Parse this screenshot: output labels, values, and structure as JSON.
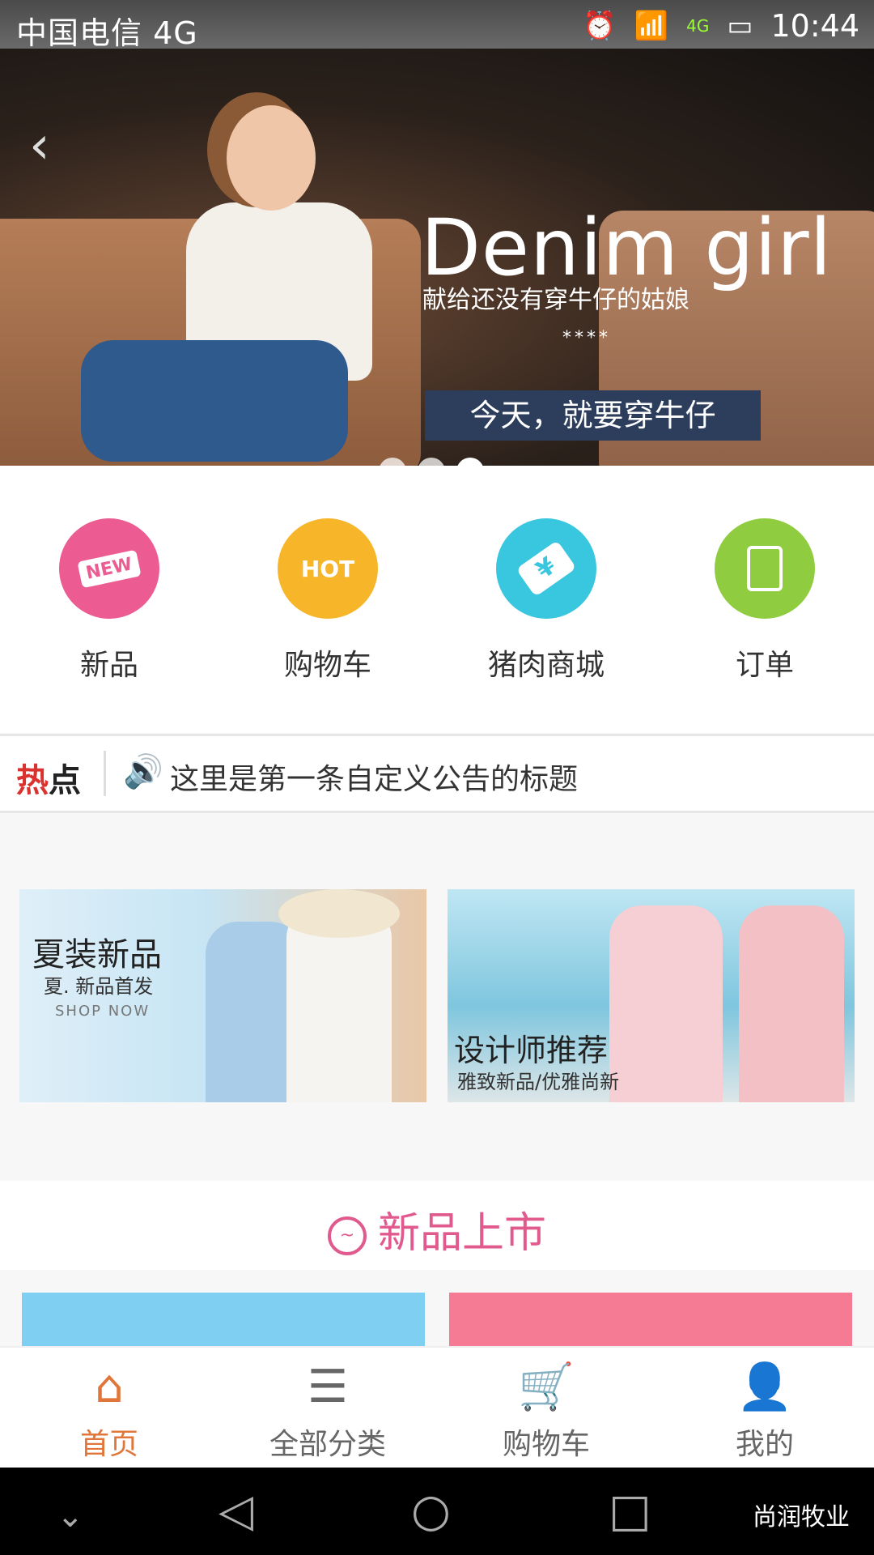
{
  "status_bar": {
    "carrier": "中国电信 4G",
    "network_badge": "4G",
    "time": "10:44",
    "icons": [
      "image-icon",
      "alarm-icon",
      "wifi-icon",
      "signal-icon",
      "sim-icon",
      "battery-icon"
    ]
  },
  "hero": {
    "title": "Denim girl",
    "subtitle": "献给还没有穿牛仔的姑娘",
    "stars": "****",
    "cta": "今天，就要穿牛仔",
    "dots": 3,
    "active_dot": 2
  },
  "quick_menu": {
    "items": [
      {
        "label": "新品",
        "badge": "NEW",
        "color": "#ec5c92",
        "icon": "new-tag-icon"
      },
      {
        "label": "购物车",
        "badge": "HOT",
        "color": "#f7b52a",
        "icon": "hot-flame-icon"
      },
      {
        "label": "猪肉商城",
        "badge": "¥",
        "color": "#39c6df",
        "icon": "price-tag-icon"
      },
      {
        "label": "订单",
        "badge": "",
        "color": "#8fcc3f",
        "icon": "clipboard-icon"
      }
    ]
  },
  "notice": {
    "tag_red": "热",
    "tag_dark": "点",
    "text": "这里是第一条自定义公告的标题"
  },
  "promos": [
    {
      "title": "夏装新品",
      "subtitle": "夏. 新品首发",
      "tag": "SHOP NOW"
    },
    {
      "title": "设计师推荐",
      "subtitle": "雅致新品/优雅尚新"
    }
  ],
  "section": {
    "title": "新品上市"
  },
  "products": [
    {
      "color": "#7ecff1"
    },
    {
      "color": "#f57b94"
    }
  ],
  "tabbar": {
    "items": [
      {
        "label": "首页",
        "icon": "home-icon",
        "active": true
      },
      {
        "label": "全部分类",
        "icon": "menu-icon",
        "active": false
      },
      {
        "label": "购物车",
        "icon": "cart-icon",
        "active": false
      },
      {
        "label": "我的",
        "icon": "user-icon",
        "active": false
      }
    ]
  },
  "navbar": {
    "watermark": "尚润牧业"
  }
}
